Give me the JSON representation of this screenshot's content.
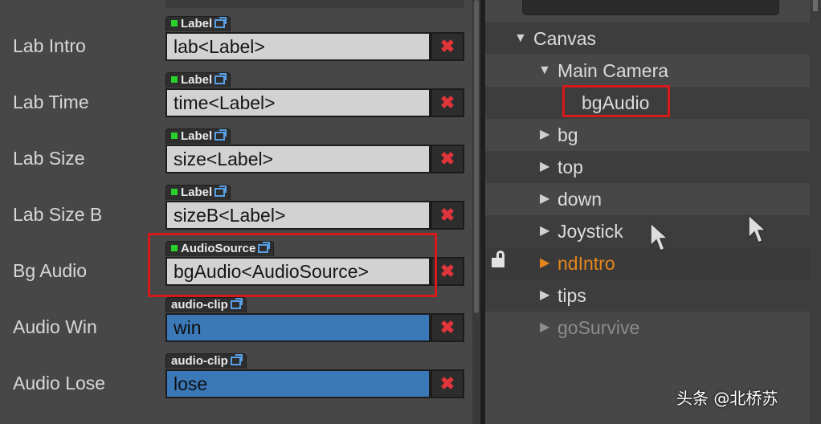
{
  "inspector": {
    "rows": [
      {
        "label": "Lab Intro",
        "tag": "Label",
        "value": "lab<Label>",
        "kind": "node"
      },
      {
        "label": "Lab Time",
        "tag": "Label",
        "value": "time<Label>",
        "kind": "node"
      },
      {
        "label": "Lab Size",
        "tag": "Label",
        "value": "size<Label>",
        "kind": "node"
      },
      {
        "label": "Lab Size B",
        "tag": "Label",
        "value": "sizeB<Label>",
        "kind": "node"
      },
      {
        "label": "Bg Audio",
        "tag": "AudioSource",
        "value": "bgAudio<AudioSource>",
        "kind": "node"
      },
      {
        "label": "Audio Win",
        "tag": "audio-clip",
        "value": "win",
        "kind": "asset"
      },
      {
        "label": "Audio Lose",
        "tag": "audio-clip",
        "value": "lose",
        "kind": "asset"
      }
    ],
    "clear_icon": "✖"
  },
  "hierarchy": {
    "items": [
      {
        "name": "Canvas",
        "expanded": true
      },
      {
        "name": "Main Camera",
        "expanded": true
      },
      {
        "name": "bgAudio"
      },
      {
        "name": "bg"
      },
      {
        "name": "top"
      },
      {
        "name": "down"
      },
      {
        "name": "Joystick"
      },
      {
        "name": "ndIntro",
        "state": "locked"
      },
      {
        "name": "tips"
      },
      {
        "name": "goSurvive",
        "state": "inactive"
      }
    ]
  },
  "colors": {
    "highlight_box": "#d61a1a",
    "asset_field": "#3b78b8",
    "node_field": "#d2d2d2",
    "locked_node": "#e5871a",
    "clear_button": "#e0353b"
  },
  "watermark": "头条 @北桥苏"
}
